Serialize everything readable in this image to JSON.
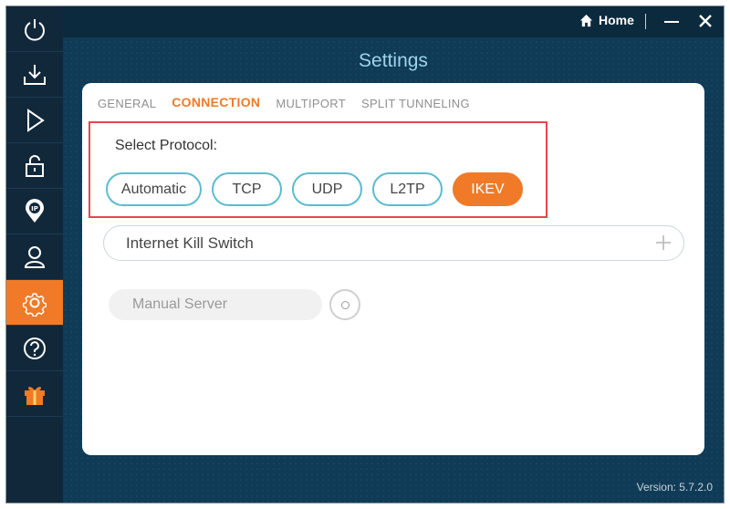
{
  "sidebar": {
    "items": [
      {
        "icon": "power-icon"
      },
      {
        "icon": "download-icon"
      },
      {
        "icon": "play-icon"
      },
      {
        "icon": "lock-icon"
      },
      {
        "icon": "ip-location-icon"
      },
      {
        "icon": "user-icon"
      },
      {
        "icon": "settings-gear-icon",
        "active": true
      },
      {
        "icon": "help-icon"
      },
      {
        "icon": "gift-icon"
      }
    ]
  },
  "titlebar": {
    "home_label": "Home",
    "home_icon": "home-icon",
    "minimize_icon": "minimize-icon",
    "close_icon": "close-icon"
  },
  "page": {
    "title": "Settings"
  },
  "tabs": [
    {
      "label": "GENERAL",
      "active": false
    },
    {
      "label": "CONNECTION",
      "active": true
    },
    {
      "label": "MULTIPORT",
      "active": false
    },
    {
      "label": "SPLIT TUNNELING",
      "active": false
    }
  ],
  "protocol": {
    "label": "Select Protocol:",
    "options": [
      "Automatic",
      "TCP",
      "UDP",
      "L2TP",
      "IKEV"
    ],
    "selected": "IKEV"
  },
  "kill_switch": {
    "label": "Internet Kill Switch",
    "expand_icon": "plus-icon"
  },
  "manual_server": {
    "label": "Manual Server",
    "enabled": false
  },
  "version_text": "Version: 5.7.2.0",
  "colors": {
    "accent": "#f07a27",
    "sidebar_bg": "#11283a",
    "main_bg": "#0f3b56",
    "title": "#9fd3ea",
    "pill_border": "#5bbcd1",
    "highlight_box": "#e5474b"
  }
}
